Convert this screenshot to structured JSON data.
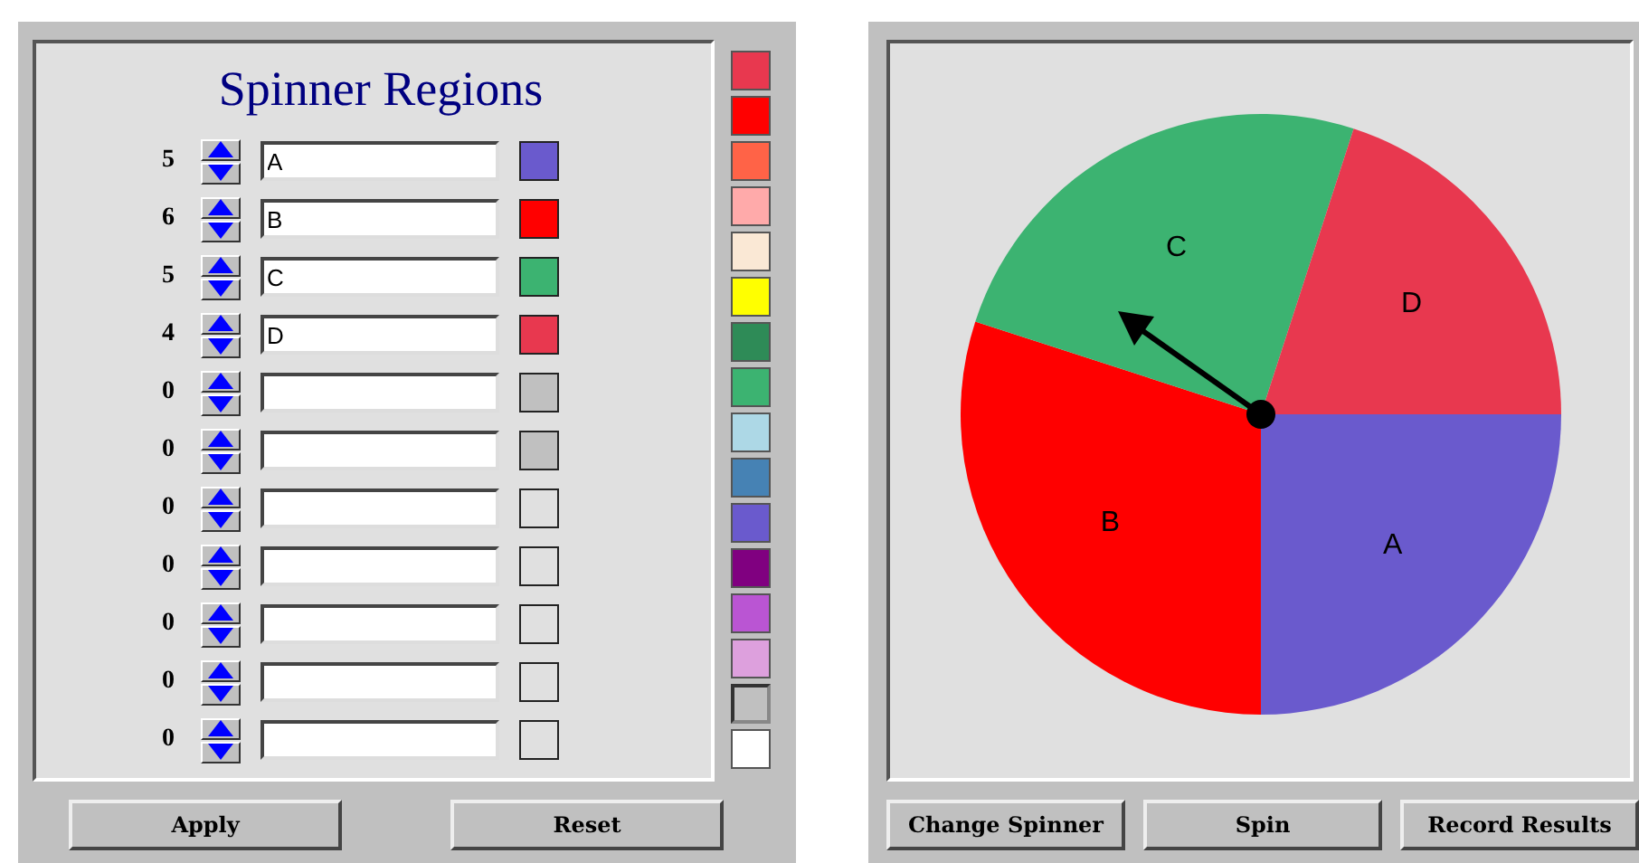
{
  "editor": {
    "title": "Spinner Regions",
    "rows": [
      {
        "count": "5",
        "name": "A",
        "color": "#6a5acd"
      },
      {
        "count": "6",
        "name": "B",
        "color": "#ff0000"
      },
      {
        "count": "5",
        "name": "C",
        "color": "#3cb371"
      },
      {
        "count": "4",
        "name": "D",
        "color": "#e8384f"
      },
      {
        "count": "0",
        "name": "",
        "color": "#c0c0c0"
      },
      {
        "count": "0",
        "name": "",
        "color": "#c0c0c0"
      },
      {
        "count": "0",
        "name": "",
        "color": "#e0e0e0"
      },
      {
        "count": "0",
        "name": "",
        "color": "#e0e0e0"
      },
      {
        "count": "0",
        "name": "",
        "color": "#e0e0e0"
      },
      {
        "count": "0",
        "name": "",
        "color": "#e0e0e0"
      },
      {
        "count": "0",
        "name": "",
        "color": "#e0e0e0"
      }
    ],
    "buttons": [
      "Apply",
      "Reset"
    ]
  },
  "palette": [
    {
      "color": "#e8384f",
      "selected": false
    },
    {
      "color": "#ff0000",
      "selected": false
    },
    {
      "color": "#ff6347",
      "selected": false
    },
    {
      "color": "#ffaaaa",
      "selected": false
    },
    {
      "color": "#fae8d5",
      "selected": false
    },
    {
      "color": "#ffff00",
      "selected": false
    },
    {
      "color": "#2e8b57",
      "selected": false
    },
    {
      "color": "#3cb371",
      "selected": false
    },
    {
      "color": "#add8e6",
      "selected": false
    },
    {
      "color": "#4682b4",
      "selected": false
    },
    {
      "color": "#6a5acd",
      "selected": false
    },
    {
      "color": "#800080",
      "selected": false
    },
    {
      "color": "#ba55d3",
      "selected": false
    },
    {
      "color": "#dda0dd",
      "selected": false
    },
    {
      "color": "#c0c0c0",
      "selected": true
    },
    {
      "color": "#ffffff",
      "selected": false
    }
  ],
  "spinner": {
    "slices": [
      {
        "label": "A"
      },
      {
        "label": "B"
      },
      {
        "label": "C"
      },
      {
        "label": "D"
      }
    ],
    "buttons": [
      "Change Spinner",
      "Spin",
      "Record Results"
    ]
  }
}
